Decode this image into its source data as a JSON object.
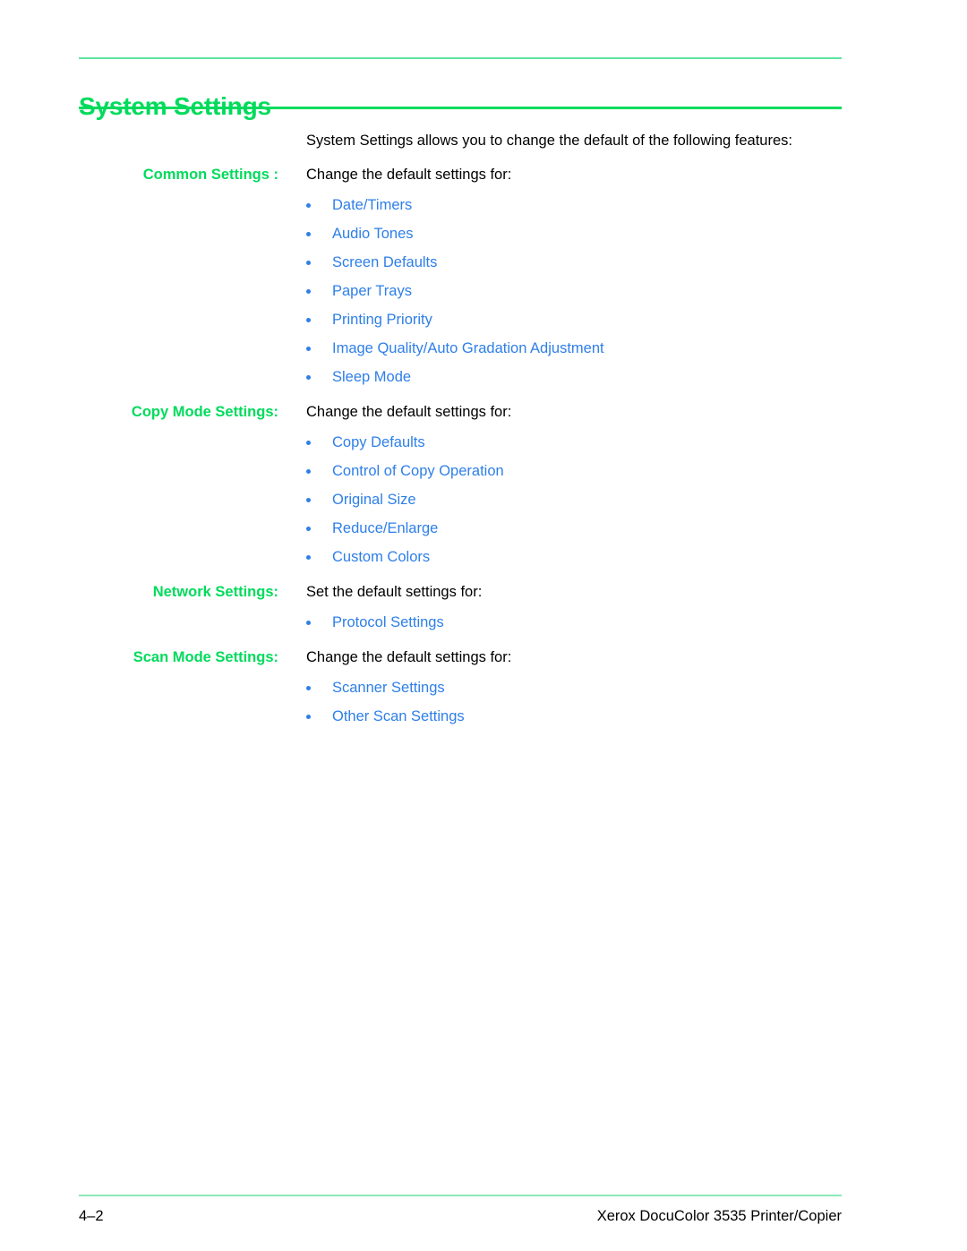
{
  "document": {
    "title": "System Settings",
    "intro": "System Settings allows you to change the default of the following features:"
  },
  "colors": {
    "heading_green": "#00db5c",
    "rule_green_light": "#5ce6a0",
    "rule_green_footer": "#8aeab8",
    "bullet_blue": "#2e7fe8",
    "body_black": "#000000"
  },
  "sections": [
    {
      "label": "Common Settings :",
      "lead": "Change the default settings for:",
      "bullets": [
        "Date/Timers",
        "Audio Tones",
        "Screen Defaults",
        "Paper Trays",
        "Printing Priority",
        "Image Quality/Auto Gradation Adjustment",
        "Sleep Mode"
      ]
    },
    {
      "label": "Copy Mode Settings:",
      "lead": "Change the default settings for:",
      "bullets": [
        "Copy Defaults",
        "Control of Copy Operation",
        "Original Size",
        "Reduce/Enlarge",
        "Custom Colors"
      ]
    },
    {
      "label": "Network Settings:",
      "lead": "Set the default settings for:",
      "bullets": [
        "Protocol Settings"
      ]
    },
    {
      "label": "Scan Mode Settings:",
      "lead": "Change the default settings for:",
      "bullets": [
        "Scanner Settings",
        "Other Scan Settings"
      ]
    }
  ],
  "footer": {
    "page_number": "4–2",
    "product": "Xerox DocuColor 3535 Printer/Copier"
  }
}
